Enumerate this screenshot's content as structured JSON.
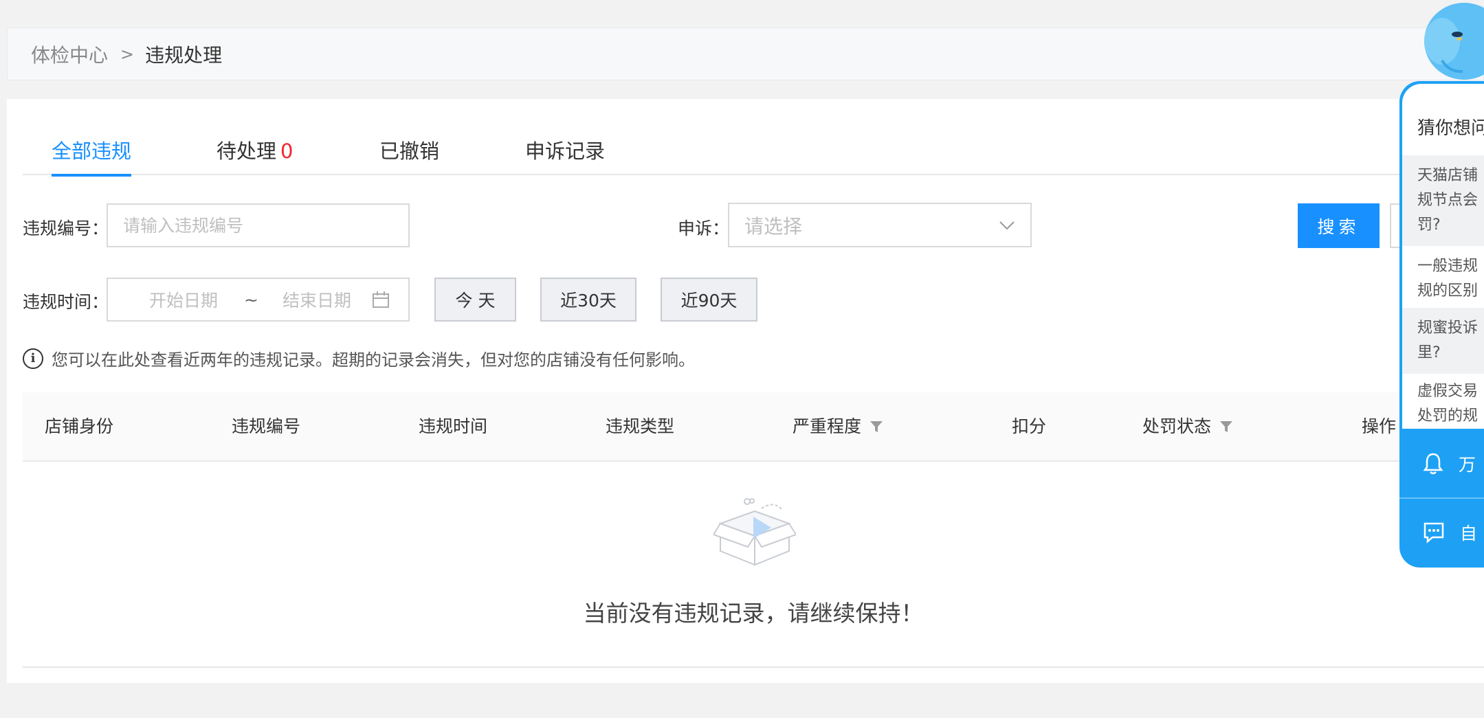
{
  "breadcrumb": {
    "root": "体检中心",
    "separator": ">",
    "current": "违规处理"
  },
  "tabs": [
    {
      "label": "全部违规",
      "active": true
    },
    {
      "label": "待处理",
      "count": "0"
    },
    {
      "label": "已撤销"
    },
    {
      "label": "申诉记录"
    }
  ],
  "filters": {
    "violation_no_label": "违规编号：",
    "violation_no_placeholder": "请输入违规编号",
    "appeal_label": "申诉：",
    "appeal_placeholder": "请选择",
    "time_label": "违规时间：",
    "start_placeholder": "开始日期",
    "range_sep": "~",
    "end_placeholder": "结束日期",
    "quick": [
      "今 天",
      "近30天",
      "近90天"
    ],
    "search_button": "搜索"
  },
  "tip": "您可以在此处查看近两年的违规记录。超期的记录会消失，但对您的店铺没有任何影响。",
  "table": {
    "columns": [
      "店铺身份",
      "违规编号",
      "违规时间",
      "违规类型",
      "严重程度",
      "扣分",
      "处罚状态",
      "操作"
    ],
    "empty_text": "当前没有违规记录，请继续保持！"
  },
  "help_panel": {
    "title": "猜你想问",
    "items": [
      [
        "天猫店铺",
        "规节点会",
        "罚?"
      ],
      [
        "一般违规",
        "规的区别"
      ],
      [
        "规蜜投诉",
        "里?"
      ],
      [
        "虚假交易",
        "处罚的规"
      ]
    ],
    "actions": [
      "万",
      "自"
    ]
  },
  "colors": {
    "accent": "#1890ff",
    "count_red": "#f5222d",
    "panel_blue": "#1ea1f5"
  }
}
